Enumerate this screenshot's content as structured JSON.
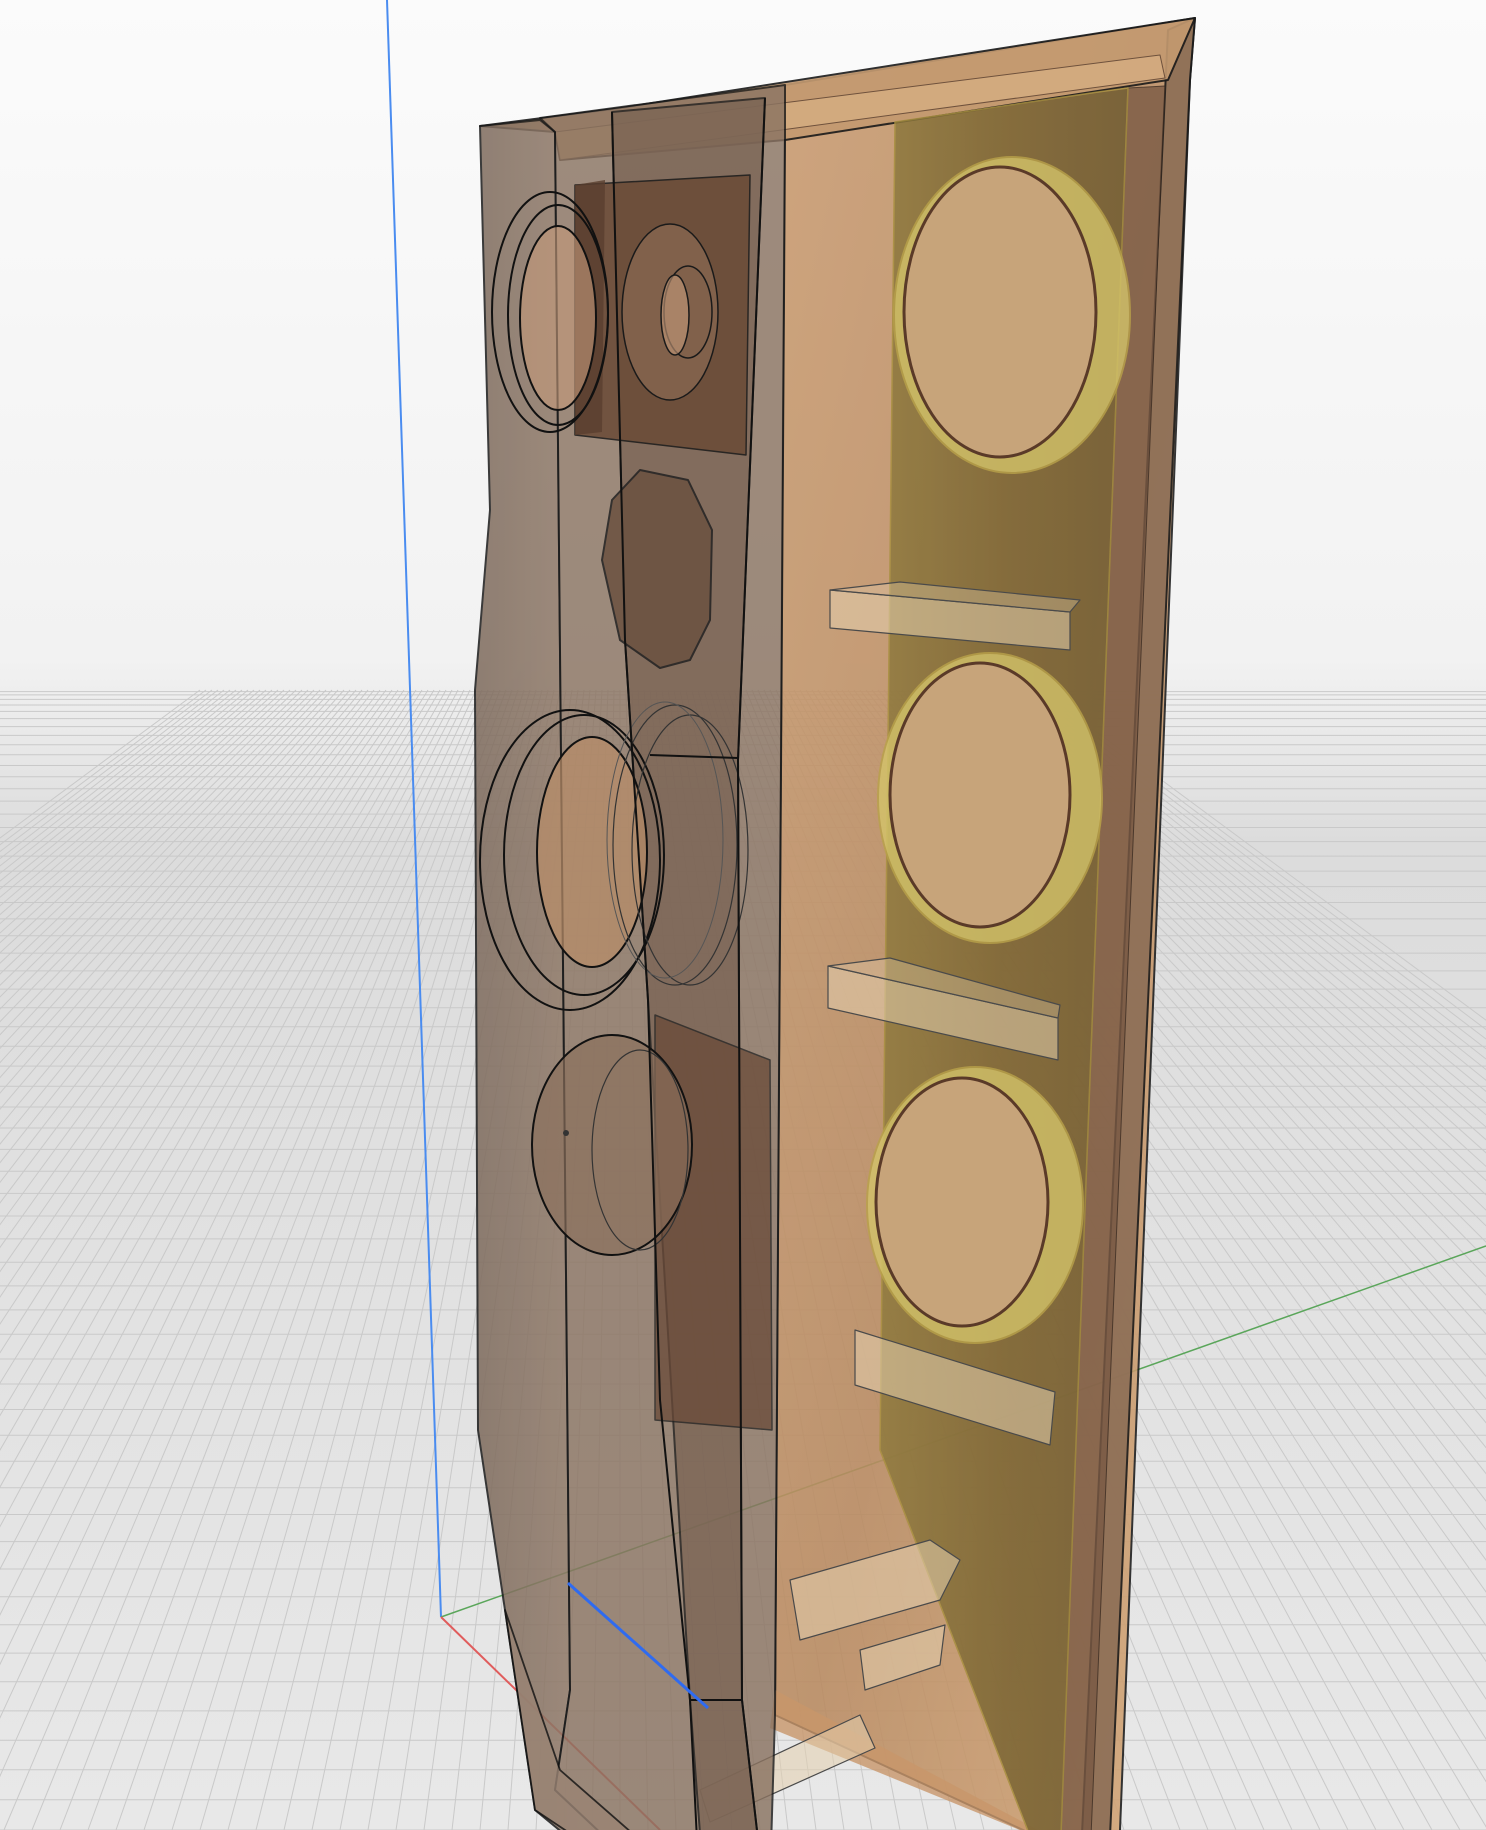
{
  "viewport": {
    "scene": "speaker-cabinet-model",
    "display_mode": "transparent-wireframe",
    "colors": {
      "background_top": "#f5f5f5",
      "background_horizon": "#d9d9d9",
      "grid_line": "#c9c9c9",
      "x_axis": "#e05c5c",
      "y_axis": "#5aa65a",
      "z_axis": "#4a8cf0",
      "wood": "#b08158",
      "wood_dark": "#6e4e37",
      "baffle_yellow": "#c9a94a",
      "edge": "#1a1a1a"
    }
  }
}
